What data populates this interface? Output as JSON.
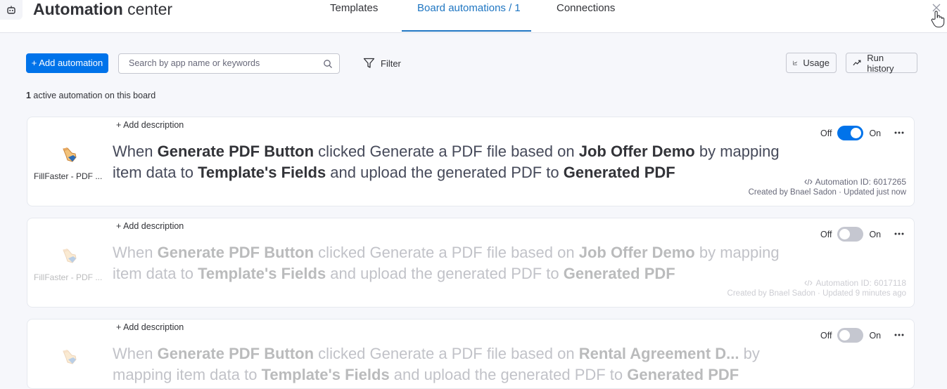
{
  "header": {
    "title_bold": "Automation",
    "title_rest": " center",
    "tabs": [
      {
        "label": "Templates",
        "active": false
      },
      {
        "label": "Board automations / 1",
        "active": true
      },
      {
        "label": "Connections",
        "active": false
      }
    ],
    "robot_icon": "robot-icon",
    "close_icon": "close-icon"
  },
  "toolbar": {
    "add_label": "+ Add automation",
    "search_placeholder": "Search by app name or keywords",
    "filter_label": "Filter",
    "usage_label": "Usage",
    "history_label": "Run history"
  },
  "summary": {
    "count": "1",
    "text": " active automation on this board"
  },
  "automations": [
    {
      "add_description": "+ Add description",
      "app_name": "FillFaster - PDF ...",
      "recipe": {
        "w1": "When ",
        "b1": "Generate PDF Button",
        "w2": " clicked Generate a PDF file based on ",
        "b2": "Job Offer Demo",
        "w3": " by mapping item data to ",
        "b3": "Template's Fields",
        "w4": " and upload the generated PDF to ",
        "b4": "Generated PDF"
      },
      "off_label": "Off",
      "on_label": "On",
      "enabled": true,
      "automation_id": "Automation ID: 6017265",
      "created": "Created by Bnael Sadon · Updated just now"
    },
    {
      "add_description": "+ Add description",
      "app_name": "FillFaster - PDF ...",
      "recipe": {
        "w1": "When ",
        "b1": "Generate PDF Button",
        "w2": " clicked Generate a PDF file based on ",
        "b2": "Job Offer Demo",
        "w3": " by mapping item data to ",
        "b3": "Template's Fields",
        "w4": " and upload the generated PDF to ",
        "b4": "Generated PDF"
      },
      "off_label": "Off",
      "on_label": "On",
      "enabled": false,
      "automation_id": "Automation ID: 6017118",
      "created": "Created by Bnael Sadon · Updated 9 minutes ago"
    },
    {
      "add_description": "+ Add description",
      "recipe": {
        "w1": "When ",
        "b1": "Generate PDF Button",
        "w2": " clicked Generate a PDF file based on ",
        "b2": "Rental Agreement D...",
        "w3": " by mapping item data to ",
        "b3": "Template's Fields",
        "w4": " and upload the generated PDF to ",
        "b4": "Generated PDF"
      },
      "off_label": "Off",
      "on_label": "On",
      "enabled": false
    }
  ],
  "colors": {
    "primary": "#0073ea",
    "active_tab": "#1f76c2",
    "toggle_off": "#c5c7d0"
  }
}
